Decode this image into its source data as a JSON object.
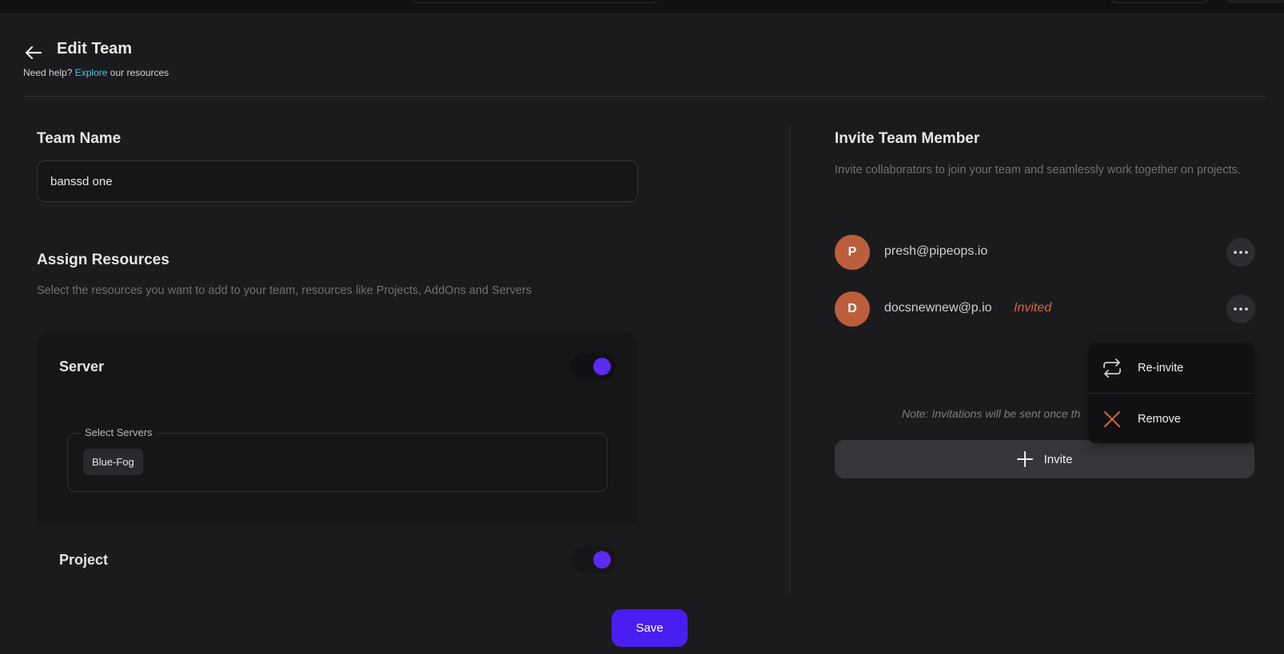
{
  "header": {
    "title": "Edit Team",
    "help_prefix": "Need help?",
    "help_link": "Explore",
    "help_suffix": "our resources"
  },
  "team_name": {
    "label": "Team Name",
    "value": "banssd one"
  },
  "assign": {
    "title": "Assign Resources",
    "subtitle": "Select the resources you want to add to your team, resources like Projects, AddOns and Servers",
    "server": {
      "label": "Server",
      "enabled": true,
      "select_label": "Select Servers",
      "selected": [
        "Blue-Fog"
      ]
    },
    "project": {
      "label": "Project",
      "enabled": true
    }
  },
  "invite": {
    "title": "Invite Team Member",
    "subtitle": "Invite collaborators to join your team and seamlessly work together on projects.",
    "members": [
      {
        "initial": "P",
        "email": "presh@pipeops.io",
        "status": ""
      },
      {
        "initial": "D",
        "email": "docsnewnew@p.io",
        "status": "Invited"
      }
    ],
    "note": "Note: Invitations will be sent once th",
    "invite_label": "Invite"
  },
  "menu": {
    "reinvite_label": "Re-invite",
    "remove_label": "Remove"
  },
  "save_label": "Save",
  "colors": {
    "accent": "#4a1ef0",
    "avatar": "#bb5e3c",
    "invited": "#d8643c",
    "link": "#52c6e6"
  }
}
